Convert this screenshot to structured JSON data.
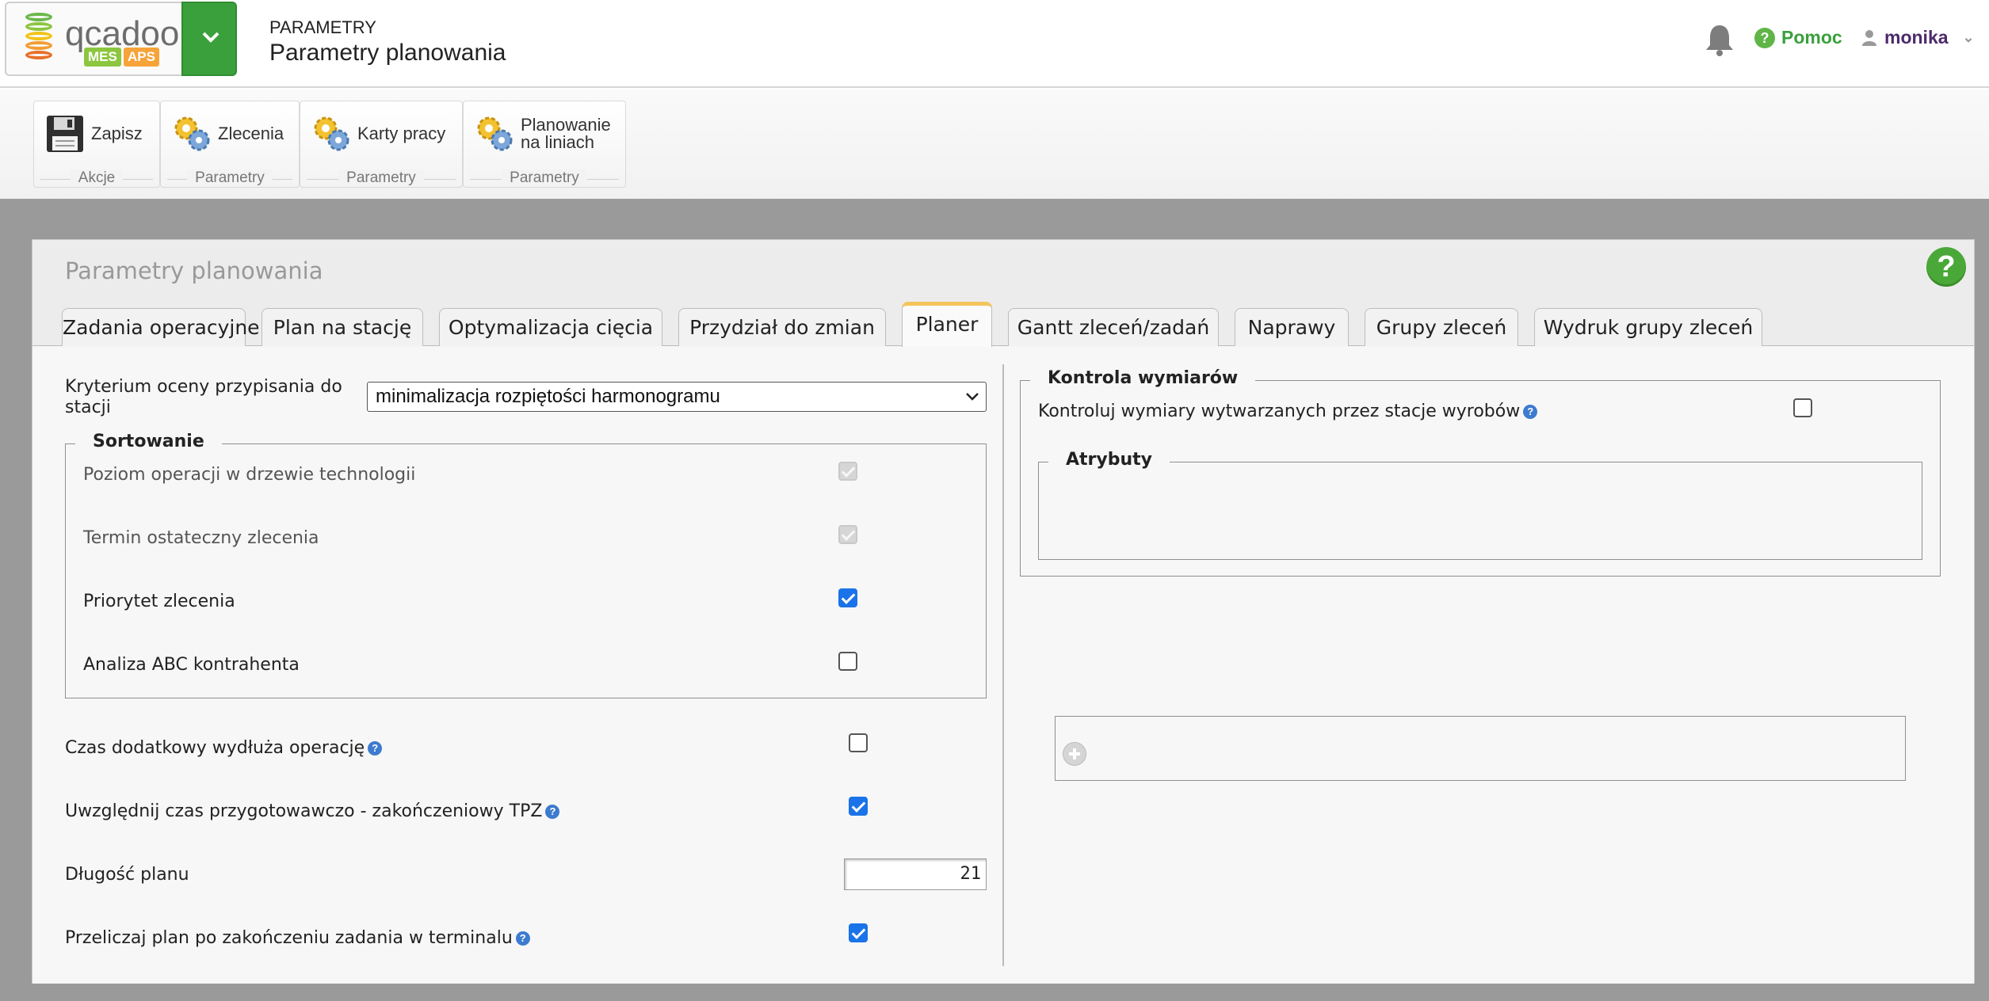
{
  "header": {
    "logo_word": "qcadoo",
    "logo_tag_mes": "MES",
    "logo_tag_aps": "APS",
    "section": "PARAMETRY",
    "title": "Parametry planowania",
    "help_label": "Pomoc",
    "user_name": "monika"
  },
  "ribbon": {
    "groups": [
      {
        "label": "Akcje",
        "button": "Zapisz",
        "icon": "floppy-disk-icon"
      },
      {
        "label": "Parametry",
        "button": "Zlecenia",
        "icon": "gears-icon"
      },
      {
        "label": "Parametry",
        "button": "Karty pracy",
        "icon": "gears-icon"
      },
      {
        "label": "Parametry",
        "button_line1": "Planowanie",
        "button_line2": "na liniach",
        "icon": "gears-icon"
      }
    ]
  },
  "panel": {
    "title": "Parametry planowania",
    "help_icon": "?",
    "tabs": [
      "Zadania operacyjne",
      "Plan na stację",
      "Optymalizacja cięcia",
      "Przydział do zmian",
      "Planer",
      "Gantt zleceń/zadań",
      "Naprawy",
      "Grupy zleceń",
      "Wydruk grupy zleceń"
    ],
    "active_tab": "Planer"
  },
  "left": {
    "criterion_label_line1": "Kryterium oceny przypisania do",
    "criterion_label_line2": "stacji",
    "criterion_value": "minimalizacja rozpiętości harmonogramu",
    "sorting": {
      "legend": "Sortowanie",
      "items": [
        {
          "label": "Poziom operacji w drzewie technologii",
          "checked": true,
          "disabled": true
        },
        {
          "label": "Termin ostateczny zlecenia",
          "checked": true,
          "disabled": true
        },
        {
          "label": "Priorytet zlecenia",
          "checked": true,
          "disabled": false
        },
        {
          "label": "Analiza ABC kontrahenta",
          "checked": false,
          "disabled": false
        }
      ]
    },
    "extra_time_label": "Czas dodatkowy wydłuża operację",
    "extra_time_checked": false,
    "tpz_label": "Uwzględnij czas przygotowawczo - zakończeniowy TPZ",
    "tpz_checked": true,
    "plan_length_label": "Długość planu",
    "plan_length_value": "21",
    "recalc_label": "Przeliczaj plan po zakończeniu zadania w terminalu",
    "recalc_checked": true
  },
  "right": {
    "dim_legend": "Kontrola wymiarów",
    "dim_label": "Kontroluj wymiary wytwarzanych przez stacje wyrobów",
    "dim_checked": false,
    "attr_legend": "Atrybuty"
  },
  "colors": {
    "accent_green": "#3aa03c",
    "checkbox_blue": "#1a73e8",
    "active_tab_border": "#f5c55b"
  }
}
